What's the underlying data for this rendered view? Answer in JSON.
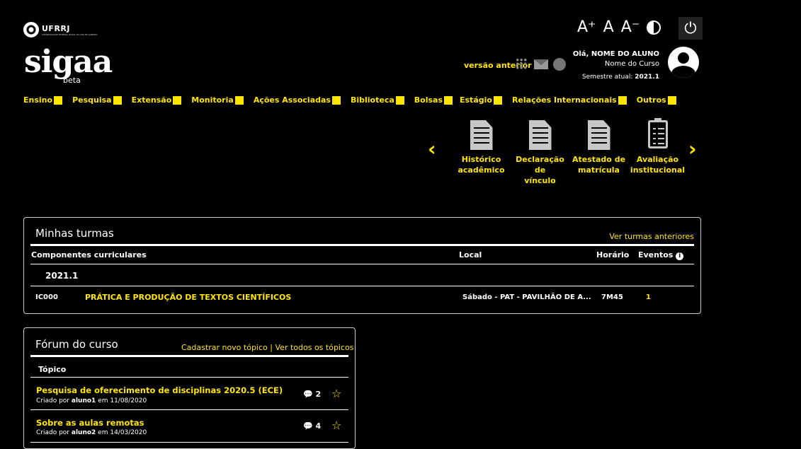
{
  "header": {
    "ufrrj": "UFRRJ",
    "ufrrj_sub": "UNIVERSIDADE FEDERAL RURAL DO RIO DE JANEIRO",
    "logo": "sigaa",
    "beta": "beta",
    "font_increase": "A⁺",
    "font_normal": "A",
    "font_decrease": "A⁻",
    "versao_anterior": "versão anterior",
    "hello": "Olá, NOME DO ALUNO",
    "course": "Nome do Curso",
    "semester_label": "Semestre atual:",
    "semester_value": "2021.1"
  },
  "menu": [
    "Ensino",
    "Pesquisa",
    "Extensão",
    "Monitoria",
    "Ações Associadas",
    "Biblioteca",
    "Bolsas",
    "Estágio",
    "Relações Internacionais",
    "Outros"
  ],
  "shortcuts": [
    {
      "line1": "Histórico",
      "line2": "acadêmico",
      "icon": "document-icon"
    },
    {
      "line1": "Declaração de",
      "line2": "vínculo",
      "icon": "document-icon"
    },
    {
      "line1": "Atestado de",
      "line2": "matrícula",
      "icon": "document-icon"
    },
    {
      "line1": "Avaliação",
      "line2": "institucional",
      "icon": "clipboard-icon"
    }
  ],
  "turmas": {
    "title": "Minhas turmas",
    "link": "Ver turmas anteriores",
    "headers": {
      "componentes": "Componentes curriculares",
      "local": "Local",
      "horario": "Horário",
      "eventos": "Eventos"
    },
    "period": "2021.1",
    "row": {
      "code": "IC000",
      "name": "PRÁTICA E PRODUÇÃO DE TEXTOS CIENTÍFICOS",
      "local": "Sábado - PAT - PAVILHÃO DE A...",
      "horario": "7M45",
      "eventos": "1"
    }
  },
  "forum": {
    "title": "Fórum do curso",
    "link_new": "Cadastrar novo tópico",
    "sep": "|",
    "link_all": "Ver todos os tópicos",
    "header": "Tópico",
    "topics": [
      {
        "title": "Pesquisa de oferecimento de disciplinas 2020.5 (ECE)",
        "by": "Criado por",
        "author": "aluno1",
        "on": "em 11/08/2020",
        "count": "2"
      },
      {
        "title": "Sobre as aulas remotas",
        "by": "Criado por",
        "author": "aluno2",
        "on": "em 14/03/2020",
        "count": "4"
      }
    ]
  }
}
